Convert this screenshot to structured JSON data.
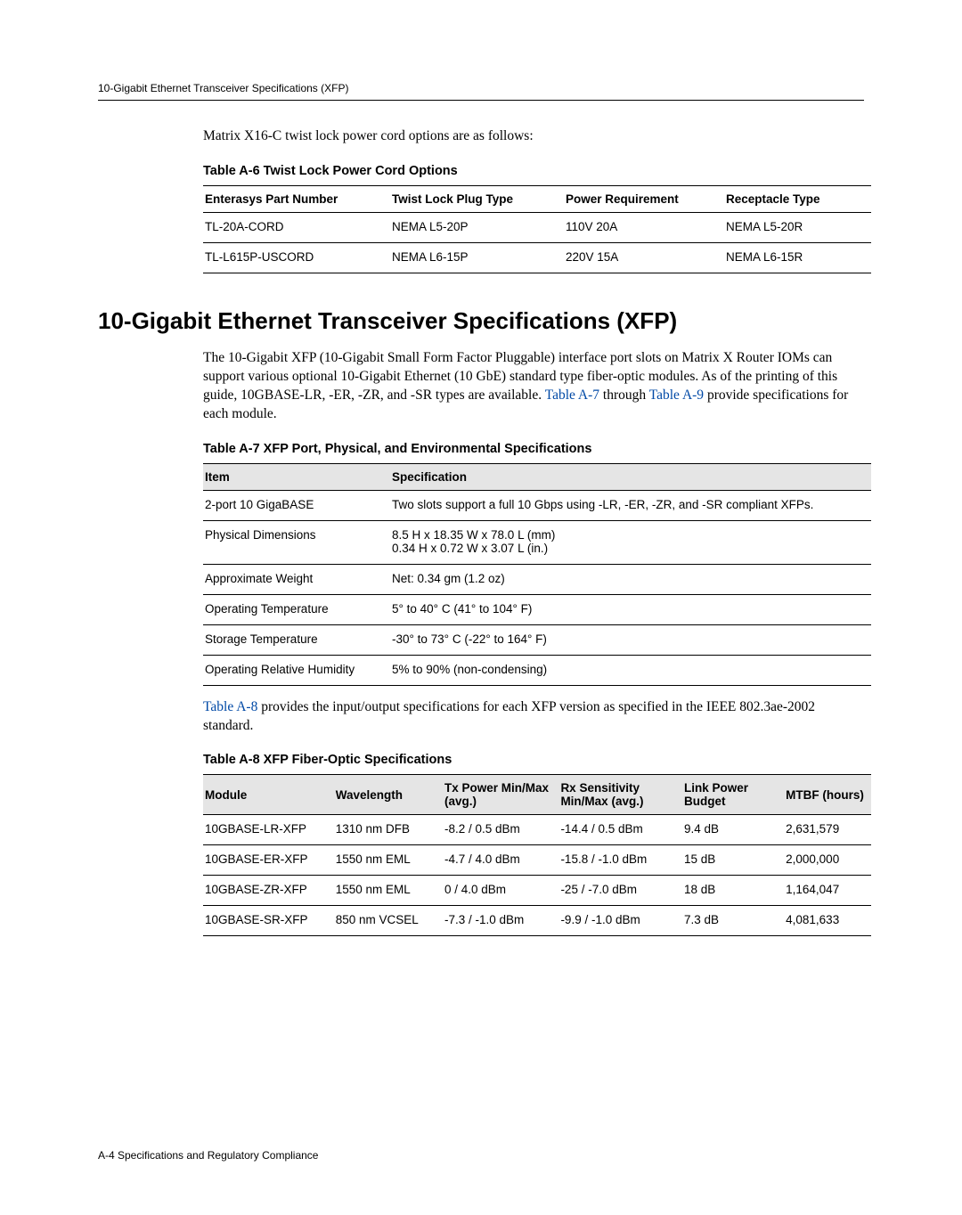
{
  "running_header": "10-Gigabit Ethernet Transceiver Specifications (XFP)",
  "intro_line": "Matrix X16-C twist lock power cord options are as follows:",
  "tableA6": {
    "caption": "Table A-6   Twist Lock Power Cord Options",
    "headers": [
      "Enterasys Part Number",
      "Twist Lock Plug Type",
      "Power Requirement",
      "Receptacle Type"
    ],
    "rows": [
      [
        "TL-20A-CORD",
        "NEMA L5-20P",
        "110V 20A",
        "NEMA L5-20R"
      ],
      [
        "TL-L615P-USCORD",
        "NEMA L6-15P",
        "220V 15A",
        "NEMA L6-15R"
      ]
    ]
  },
  "h1": "10-Gigabit Ethernet Transceiver Specifications (XFP)",
  "para1_a": "The 10-Gigabit XFP (10-Gigabit Small Form Factor Pluggable) interface port slots on Matrix X Router IOMs can support various optional 10-Gigabit Ethernet (10 GbE) standard type fiber-optic modules. As of the printing of this guide, 10GBASE-LR, -ER, -ZR, and -SR types are available. ",
  "link_a7": "Table A-7",
  "para1_mid": " through ",
  "link_a9": "Table A-9",
  "para1_end": " provide specifications for each module.",
  "tableA7": {
    "caption": "Table A-7   XFP Port, Physical, and Environmental Specifications",
    "headers": [
      "Item",
      "Specification"
    ],
    "rows": [
      [
        "2-port 10 GigaBASE",
        "Two slots support a full 10 Gbps using -LR, -ER, -ZR, and -SR compliant XFPs."
      ],
      [
        "Physical Dimensions",
        "8.5 H x 18.35 W x 78.0 L (mm)\n0.34 H x 0.72 W x 3.07 L (in.)"
      ],
      [
        "Approximate Weight",
        "Net: 0.34 gm (1.2 oz)"
      ],
      [
        "Operating Temperature",
        "5° to 40° C (41° to 104° F)"
      ],
      [
        "Storage Temperature",
        "-30° to 73° C (-22° to 164° F)"
      ],
      [
        "Operating Relative Humidity",
        "5% to 90% (non-condensing)"
      ]
    ]
  },
  "para2_a": "",
  "link_a8": "Table A-8",
  "para2_b": " provides the input/output specifications for each XFP version as specified in the IEEE 802.3ae-2002 standard.",
  "tableA8": {
    "caption": "Table A-8   XFP Fiber-Optic Specifications",
    "headers": [
      "Module",
      "Wavelength",
      "Tx Power Min/Max (avg.)",
      "Rx Sensitivity Min/Max (avg.)",
      "Link Power Budget",
      "MTBF (hours)"
    ],
    "rows": [
      [
        "10GBASE-LR-XFP",
        "1310 nm DFB",
        "-8.2 / 0.5 dBm",
        "-14.4 / 0.5 dBm",
        "9.4 dB",
        "2,631,579"
      ],
      [
        "10GBASE-ER-XFP",
        "1550 nm EML",
        "-4.7 / 4.0 dBm",
        "-15.8 / -1.0 dBm",
        "15 dB",
        "2,000,000"
      ],
      [
        "10GBASE-ZR-XFP",
        "1550 nm EML",
        "0 / 4.0 dBm",
        "-25 / -7.0 dBm",
        "18 dB",
        "1,164,047"
      ],
      [
        "10GBASE-SR-XFP",
        "850 nm VCSEL",
        "-7.3 / -1.0 dBm",
        "-9.9 / -1.0 dBm",
        "7.3 dB",
        "4,081,633"
      ]
    ]
  },
  "footer": "A-4   Specifications and Regulatory Compliance"
}
